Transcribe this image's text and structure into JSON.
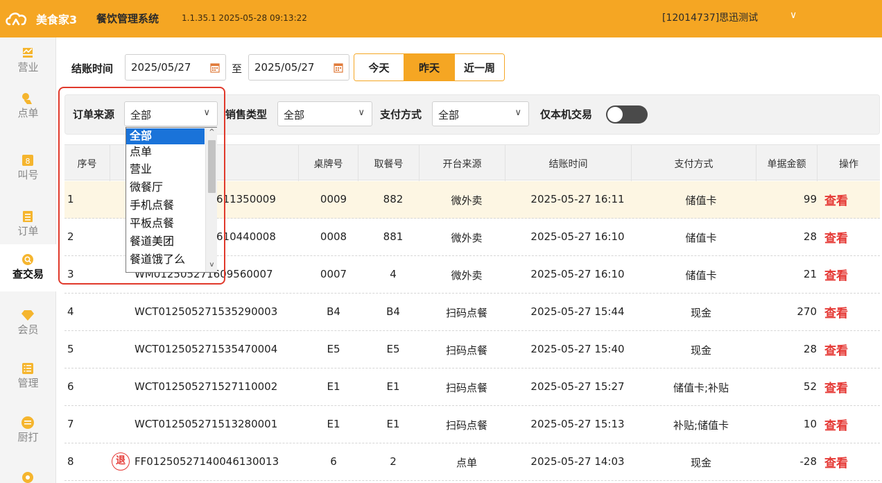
{
  "header": {
    "brand": "美食家3",
    "system_name": "餐饮管理系统",
    "version": "1.1.35.1 2025-05-28 09:13:22",
    "user": "[12014737]思迅测试",
    "user_caret": "∨"
  },
  "sidebar": {
    "items": [
      {
        "label": "营业",
        "icon": "chart-icon"
      },
      {
        "label": "点单",
        "icon": "hand-icon"
      },
      {
        "label": "叫号",
        "icon": "number-icon"
      },
      {
        "label": "订单",
        "icon": "list-icon"
      },
      {
        "label": "查交易",
        "icon": "search-icon",
        "active": true
      },
      {
        "label": "会员",
        "icon": "diamond-icon"
      },
      {
        "label": "管理",
        "icon": "checklist-icon"
      },
      {
        "label": "厨打",
        "icon": "kitchen-icon"
      }
    ]
  },
  "filters": {
    "checkout_time_label": "结账时间",
    "date_from": "2025/05/27",
    "to_label": "至",
    "date_to": "2025/05/27",
    "quick_ranges": [
      "今天",
      "昨天",
      "近一周"
    ],
    "quick_selected": "昨天",
    "order_source_label": "订单来源",
    "order_source_value": "全部",
    "sale_type_label": "销售类型",
    "sale_type_value": "全部",
    "payment_label": "支付方式",
    "payment_value": "全部",
    "local_only_label": "仅本机交易",
    "local_only_on": false
  },
  "dropdown": {
    "options": [
      "全部",
      "点单",
      "营业",
      "微餐厅",
      "手机点餐",
      "平板点餐",
      "餐道美团",
      "餐道饿了么"
    ],
    "selected": "全部"
  },
  "table": {
    "headers": [
      "序号",
      "",
      "桌牌号",
      "取餐号",
      "开台来源",
      "结账时间",
      "支付方式",
      "单据金额",
      "操作"
    ],
    "view_label": "查看",
    "refund_label": "退",
    "rows": [
      {
        "no": "1",
        "order": "611350009",
        "table": "0009",
        "pickup": "882",
        "source": "微外卖",
        "time": "2025-05-27 16:11",
        "payment": "储值卡",
        "amount": "99",
        "highlight": true
      },
      {
        "no": "2",
        "order": "610440008",
        "table": "0008",
        "pickup": "881",
        "source": "微外卖",
        "time": "2025-05-27 16:10",
        "payment": "储值卡",
        "amount": "28"
      },
      {
        "no": "3",
        "order": "WM012505271609560007",
        "table": "0007",
        "pickup": "4",
        "source": "微外卖",
        "time": "2025-05-27 16:10",
        "payment": "储值卡",
        "amount": "21"
      },
      {
        "no": "4",
        "order": "WCT012505271535290003",
        "table": "B4",
        "pickup": "B4",
        "source": "扫码点餐",
        "time": "2025-05-27 15:44",
        "payment": "现金",
        "amount": "270"
      },
      {
        "no": "5",
        "order": "WCT012505271535470004",
        "table": "E5",
        "pickup": "E5",
        "source": "扫码点餐",
        "time": "2025-05-27 15:40",
        "payment": "现金",
        "amount": "28"
      },
      {
        "no": "6",
        "order": "WCT012505271527110002",
        "table": "E1",
        "pickup": "E1",
        "source": "扫码点餐",
        "time": "2025-05-27 15:27",
        "payment": "储值卡;补贴",
        "amount": "52"
      },
      {
        "no": "7",
        "order": "WCT012505271513280001",
        "table": "E1",
        "pickup": "E1",
        "source": "扫码点餐",
        "time": "2025-05-27 15:13",
        "payment": "补贴;储值卡",
        "amount": "10"
      },
      {
        "no": "8",
        "order": "FF01250527140046130013",
        "table": "6",
        "pickup": "2",
        "source": "点单",
        "time": "2025-05-27 14:03",
        "payment": "现金",
        "amount": "-28",
        "refund": true
      }
    ]
  },
  "colors": {
    "accent": "#f5a623",
    "view_link": "#e53935",
    "dropdown_selected": "#1a73d9",
    "highlight_box": "#e0392b"
  }
}
